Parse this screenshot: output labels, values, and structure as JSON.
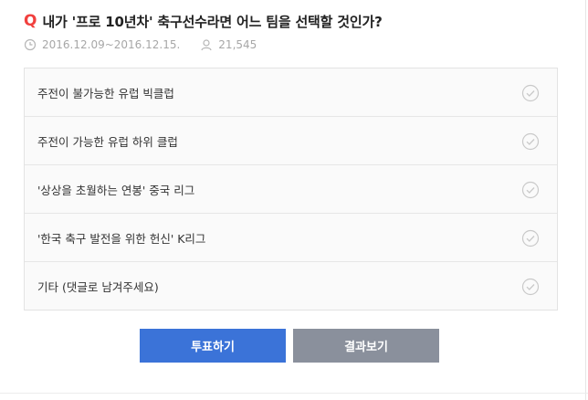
{
  "header": {
    "badge": "Q",
    "title": "내가 '프로 10년차' 축구선수라면 어느 팀을 선택할 것인가?",
    "date_range": "2016.12.09~2016.12.15.",
    "participants": "21,545"
  },
  "options": [
    {
      "label": "주전이 불가능한 유럽 빅클럽"
    },
    {
      "label": "주전이 가능한 유럽 하위 클럽"
    },
    {
      "label": "'상상을 초월하는 연봉' 중국 리그"
    },
    {
      "label": "'한국 축구 발전을 위한 헌신' K리그"
    },
    {
      "label": "기타 (댓글로 남겨주세요)"
    }
  ],
  "buttons": {
    "vote": "투표하기",
    "result": "결과보기"
  },
  "colors": {
    "badge": "#f1403e",
    "vote_button": "#3b73d8",
    "result_button": "#8a909c"
  },
  "icons": {
    "date": "clock-icon",
    "participants": "person-icon",
    "option_check": "check-circle-icon"
  }
}
